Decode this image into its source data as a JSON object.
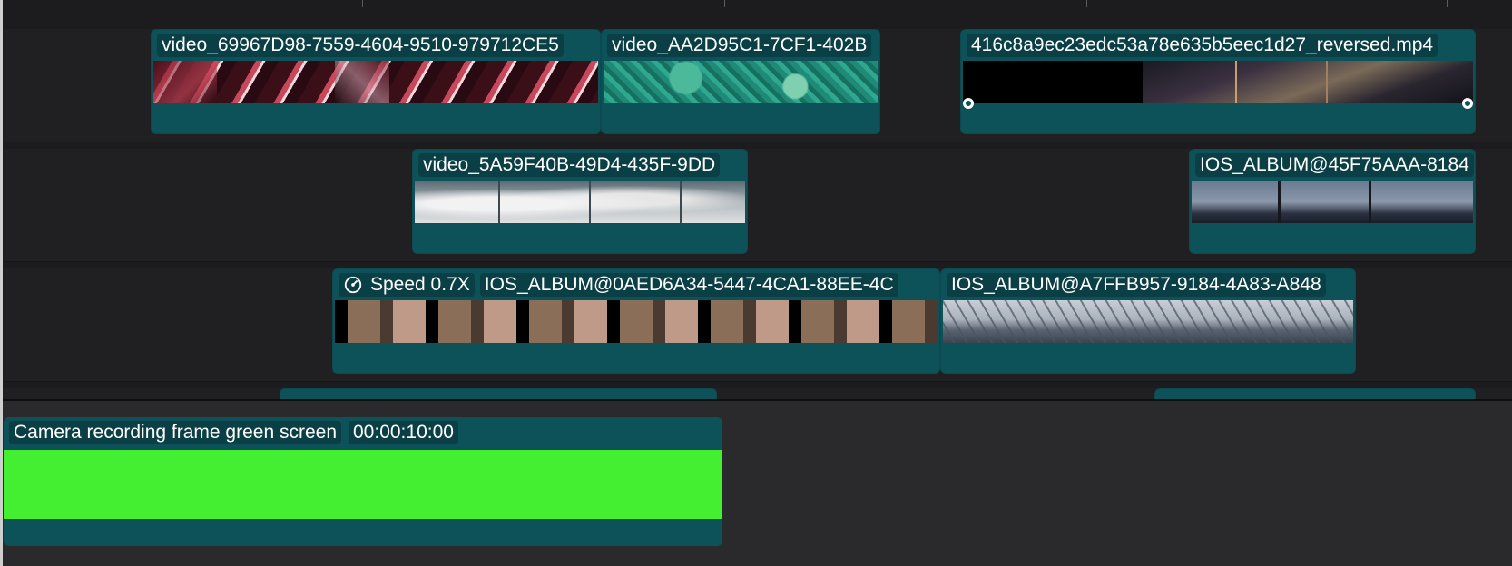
{
  "timeline": {
    "ruler": {},
    "upper_track_clips": [
      {
        "name": "video_69967D98-7559-4604-9510-979712CE5"
      },
      {
        "name": "video_AA2D95C1-7CF1-402B"
      },
      {
        "name": "416c8a9ec23edc53a78e635b5eec1d27_reversed.mp4"
      },
      {
        "name": "video_5A59F40B-49D4-435F-9DD"
      },
      {
        "name": "IOS_ALBUM@45F75AAA-8184"
      },
      {
        "speed": "Speed 0.7X",
        "name": "IOS_ALBUM@0AED6A34-5447-4CA1-88EE-4C"
      },
      {
        "name": "IOS_ALBUM@A7FFB957-9184-4A83-A848"
      }
    ]
  },
  "main_track": {
    "clip": {
      "title": "Camera recording frame green screen",
      "duration": "00:00:10:00",
      "color": "#43ef30"
    }
  },
  "colors": {
    "clip_bg": "#0c5258",
    "label_bg": "#0a3f45",
    "timeline_bg": "#1c1c1e"
  }
}
